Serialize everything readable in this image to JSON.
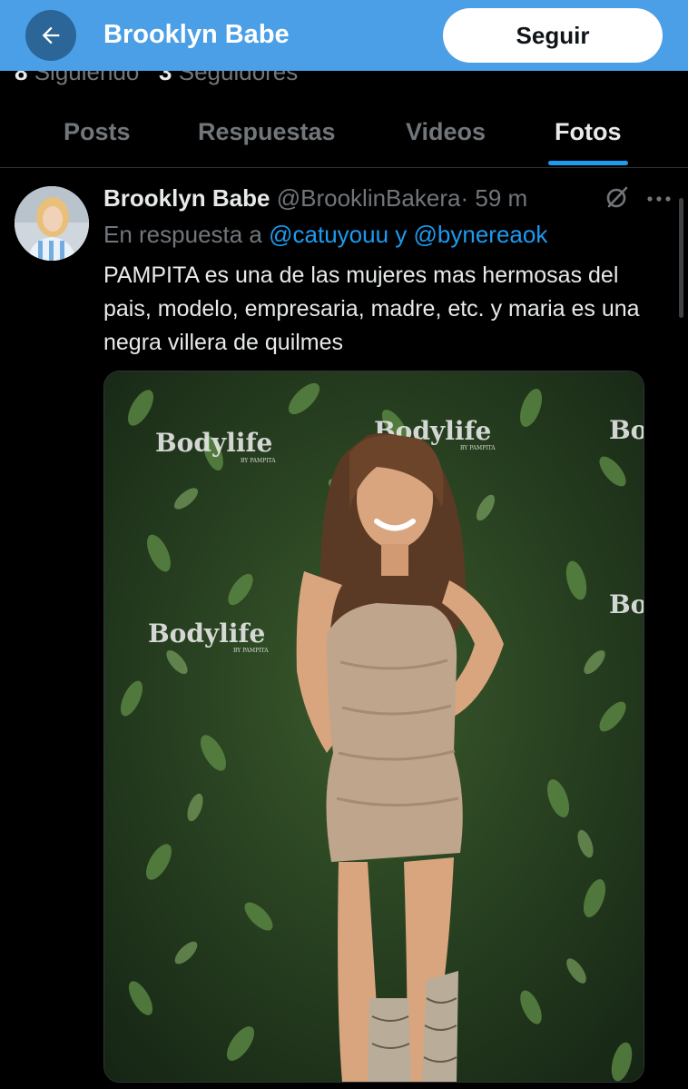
{
  "header": {
    "title": "Brooklyn Babe",
    "follow_label": "Seguir"
  },
  "profile_stats": {
    "following_count": "8",
    "following_label": "Siguiendo",
    "followers_count": "3",
    "followers_label": "Seguidores"
  },
  "tabs": [
    {
      "label": "Posts",
      "active": false
    },
    {
      "label": "Respuestas",
      "active": false
    },
    {
      "label": "Videos",
      "active": false
    },
    {
      "label": "Fotos",
      "active": true
    }
  ],
  "post": {
    "author_name": "Brooklyn Babe",
    "handle": "@BrooklinBakera",
    "separator": "·",
    "time": "59 m",
    "reply_prefix": "En respuesta a",
    "mention_1": "@catuyouu",
    "conjunction": "y",
    "mention_2": "@bynereaok",
    "text": "PAMPITA es una de las mujeres mas hermosas del pais, modelo, empresaria, madre, etc. y maria es una negra villera de quilmes",
    "photo": {
      "brand_text": "Bodylife",
      "brand_sub": "BY PAMPITA",
      "brand_partial": "Bo"
    }
  },
  "colors": {
    "header_bg": "#4a9fe6",
    "accent": "#1d9bf0",
    "background": "#000000",
    "muted_text": "#71767b"
  },
  "icons": [
    "back-arrow-icon",
    "grok-icon",
    "more-options-icon"
  ]
}
